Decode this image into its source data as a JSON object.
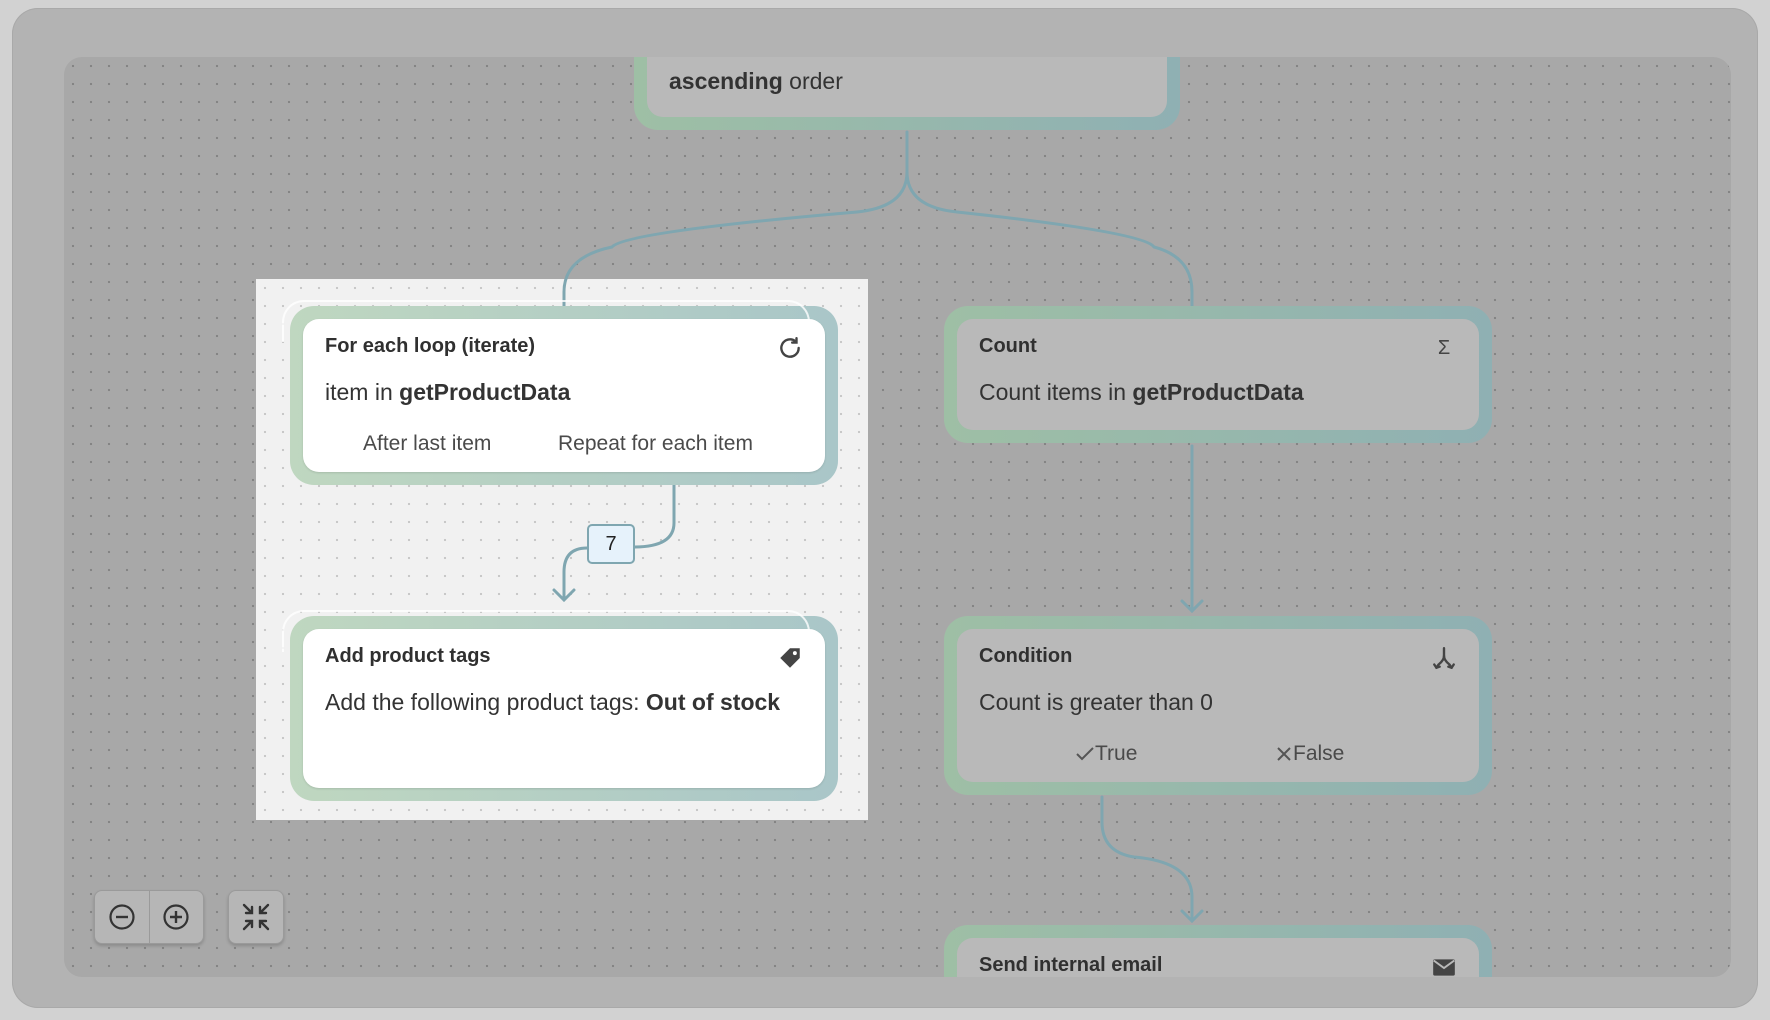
{
  "top_node": {
    "line2_bold": "ascending",
    "line2_rest": " order"
  },
  "loop_node": {
    "title": "For each loop (iterate)",
    "desc_prefix": "item in ",
    "desc_bold": "getProductData",
    "branch_after": "After last item",
    "branch_repeat": "Repeat for each item",
    "icon": "refresh-icon"
  },
  "connector_badge": "7",
  "tags_node": {
    "title": "Add product tags",
    "desc_prefix": "Add the following product tags: ",
    "desc_bold": "Out of stock",
    "icon": "tag-icon"
  },
  "count_node": {
    "title": "Count",
    "desc_prefix": "Count items in ",
    "desc_bold": "getProductData",
    "icon_glyph": "Σ",
    "icon": "sigma-icon"
  },
  "condition_node": {
    "title": "Condition",
    "desc": "Count is greater than 0",
    "branch_true": "True",
    "branch_false": "False",
    "icon": "split-icon"
  },
  "email_node": {
    "title": "Send internal email",
    "icon": "mail-icon"
  },
  "controls": {
    "zoom_out_icon": "zoom-out-icon",
    "zoom_in_icon": "zoom-in-icon",
    "fit_icon": "collapse-icon"
  }
}
